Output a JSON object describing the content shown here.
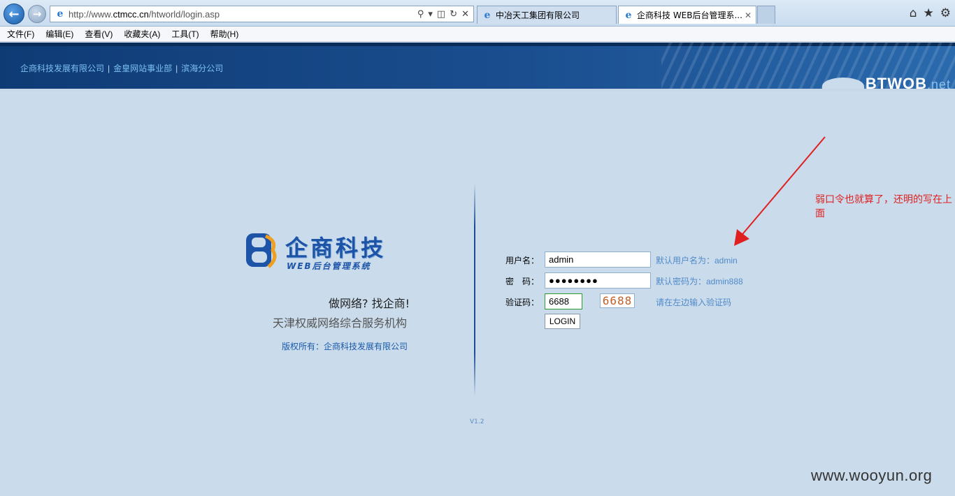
{
  "browser": {
    "url_prefix": "http://www.",
    "url_host": "ctmcc.cn",
    "url_path": "/htworld/login.asp",
    "tabs": [
      {
        "title": "中冶天工集团有限公司"
      },
      {
        "title": "企商科技 WEB后台管理系..."
      }
    ],
    "menu": [
      "文件(F)",
      "编辑(E)",
      "查看(V)",
      "收藏夹(A)",
      "工具(T)",
      "帮助(H)"
    ]
  },
  "header": {
    "links": [
      "企商科技发展有限公司",
      "金皇网站事业部",
      "滨海分公司"
    ],
    "separator": "|",
    "brand": "BTWOB",
    "brand_suffix": ".net"
  },
  "logo": {
    "name": "企商科技",
    "subtitle": "WEB后台管理系统"
  },
  "intro": {
    "slogan": "做网络? 找企商!",
    "tagline": "天津权威网络综合服务机构",
    "copyright": "版权所有：企商科技发展有限公司"
  },
  "form": {
    "username_label": "用户名：",
    "username_value": "admin",
    "password_label": "密　码：",
    "password_value": "●●●●●●●●",
    "code_label": "验证码：",
    "code_value": "6688",
    "captcha_text": "6688",
    "login_label": "LOGIN",
    "hint_user": "默认用户名为：admin",
    "hint_pass": "默认密码为：admin888",
    "hint_code": "请在左边输入验证码"
  },
  "version": "V1.2",
  "annotation": "弱口令也就算了，还明的写在上面",
  "watermark": "www.wooyun.org",
  "colors": {
    "page_bg": "#cadcec",
    "header_bg": "#1a4e8f",
    "hint": "#4f89c9",
    "annotation": "#e02020"
  }
}
